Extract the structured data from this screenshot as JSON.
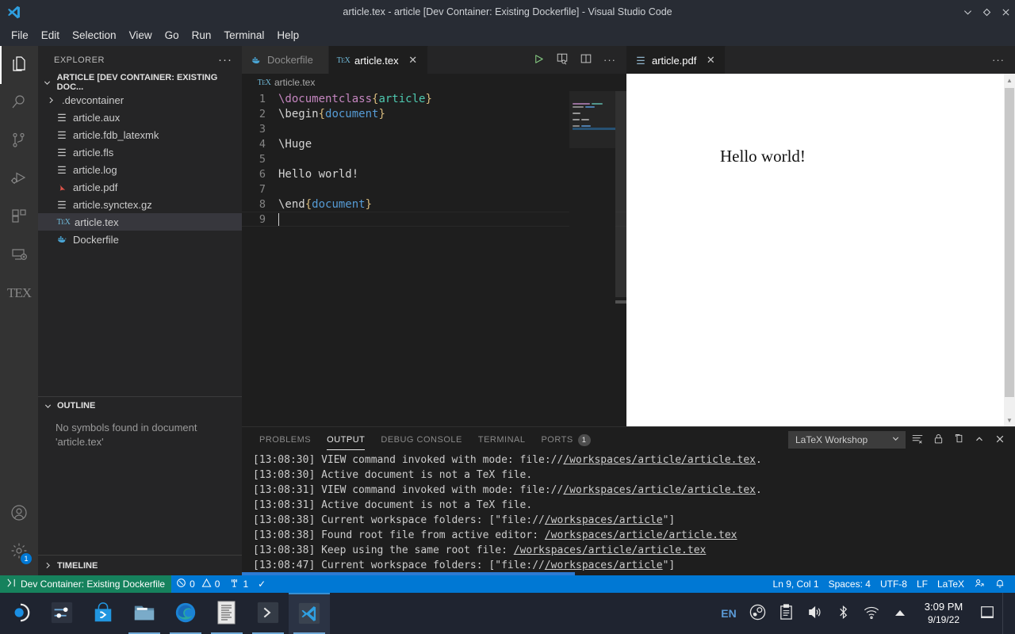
{
  "titlebar": {
    "title": "article.tex - article [Dev Container: Existing Dockerfile] - Visual Studio Code",
    "logo_icon": "vscode-logo-icon",
    "controls": [
      {
        "name": "minimize-button",
        "glyph": "⌄"
      },
      {
        "name": "maximize-button",
        "glyph": "◇"
      },
      {
        "name": "close-button",
        "glyph": "✕"
      }
    ]
  },
  "menubar": {
    "items": [
      "File",
      "Edit",
      "Selection",
      "View",
      "Go",
      "Run",
      "Terminal",
      "Help"
    ]
  },
  "activitybar": {
    "items": [
      {
        "name": "explorer",
        "icon": "files-icon",
        "active": true
      },
      {
        "name": "search",
        "icon": "search-icon",
        "active": false
      },
      {
        "name": "source-control",
        "icon": "source-control-icon",
        "active": false
      },
      {
        "name": "run-debug",
        "icon": "run-debug-icon",
        "active": false
      },
      {
        "name": "extensions",
        "icon": "extensions-icon",
        "active": false
      },
      {
        "name": "remote-explorer",
        "icon": "remote-explorer-icon",
        "active": false
      },
      {
        "name": "latex-workshop",
        "icon": "tex-icon",
        "label": "TEX",
        "active": false
      }
    ],
    "bottom": [
      {
        "name": "accounts",
        "icon": "account-icon"
      },
      {
        "name": "manage-settings",
        "icon": "gear-icon",
        "badge": "1"
      }
    ]
  },
  "sidebar": {
    "title": "EXPLORER",
    "more_actions": "···",
    "root_label": "ARTICLE [DEV CONTAINER: EXISTING DOC...",
    "files": [
      {
        "label": ".devcontainer",
        "icon": "folder-chevron-icon",
        "type": "folder",
        "selected": false
      },
      {
        "label": "article.aux",
        "icon": "file-lines-icon",
        "type": "file",
        "selected": false
      },
      {
        "label": "article.fdb_latexmk",
        "icon": "file-lines-icon",
        "type": "file",
        "selected": false
      },
      {
        "label": "article.fls",
        "icon": "file-lines-icon",
        "type": "file",
        "selected": false
      },
      {
        "label": "article.log",
        "icon": "file-lines-icon",
        "type": "file",
        "selected": false
      },
      {
        "label": "article.pdf",
        "icon": "pdf-icon",
        "type": "file",
        "selected": false
      },
      {
        "label": "article.synctex.gz",
        "icon": "file-lines-icon",
        "type": "file",
        "selected": false
      },
      {
        "label": "article.tex",
        "icon": "tex-file-icon",
        "type": "file",
        "selected": true
      },
      {
        "label": "Dockerfile",
        "icon": "docker-icon",
        "type": "file",
        "selected": false
      }
    ],
    "outline": {
      "title": "OUTLINE",
      "message_line1": "No symbols found in document",
      "message_line2": "'article.tex'"
    },
    "timeline": {
      "title": "TIMELINE"
    }
  },
  "editor": {
    "tabs": [
      {
        "label": "Dockerfile",
        "icon": "docker-icon",
        "active": false,
        "closable": false
      },
      {
        "label": "article.tex",
        "icon": "tex-file-icon",
        "active": true,
        "closable": true,
        "close_glyph": "✕"
      }
    ],
    "actions": [
      {
        "name": "build-latex-project-button",
        "icon": "play-icon"
      },
      {
        "name": "synctex-view-button",
        "icon": "view-pdf-icon"
      },
      {
        "name": "split-editor-right-button",
        "icon": "split-editor-icon"
      },
      {
        "name": "more-actions-button",
        "icon": "ellipsis-icon",
        "glyph": "···"
      }
    ],
    "breadcrumb": {
      "icon": "tex-file-icon",
      "label": "article.tex"
    },
    "lines": [
      {
        "n": "1",
        "tokens": [
          {
            "t": "\\documentclass",
            "c": "k-cmd"
          },
          {
            "t": "{",
            "c": "k-brace"
          },
          {
            "t": "article",
            "c": "k-arg-green"
          },
          {
            "t": "}",
            "c": "k-brace"
          }
        ]
      },
      {
        "n": "2",
        "tokens": [
          {
            "t": "\\begin",
            "c": "ctext"
          },
          {
            "t": "{",
            "c": "k-brace"
          },
          {
            "t": "document",
            "c": "k-arg-blue"
          },
          {
            "t": "}",
            "c": "k-brace"
          }
        ]
      },
      {
        "n": "3",
        "tokens": []
      },
      {
        "n": "4",
        "tokens": [
          {
            "t": "\\Huge",
            "c": "ctext"
          }
        ]
      },
      {
        "n": "5",
        "tokens": []
      },
      {
        "n": "6",
        "tokens": [
          {
            "t": "Hello world!",
            "c": "ctext"
          }
        ]
      },
      {
        "n": "7",
        "tokens": []
      },
      {
        "n": "8",
        "tokens": [
          {
            "t": "\\end",
            "c": "ctext"
          },
          {
            "t": "{",
            "c": "k-brace"
          },
          {
            "t": "document",
            "c": "k-arg-blue"
          },
          {
            "t": "}",
            "c": "k-brace"
          }
        ]
      },
      {
        "n": "9",
        "tokens": [],
        "cursor": true
      }
    ]
  },
  "pdf": {
    "tab": {
      "label": "article.pdf",
      "icon": "pdf-preview-icon",
      "close_glyph": "✕"
    },
    "more_actions": "···",
    "page_text": "Hello world!"
  },
  "panel": {
    "tabs": [
      {
        "label": "PROBLEMS",
        "active": false
      },
      {
        "label": "OUTPUT",
        "active": true
      },
      {
        "label": "DEBUG CONSOLE",
        "active": false
      },
      {
        "label": "TERMINAL",
        "active": false
      },
      {
        "label": "PORTS",
        "active": false,
        "badge": "1"
      }
    ],
    "channel_selected": "LaTeX Workshop",
    "channel_chevron": "chevron-down-icon",
    "actions": [
      {
        "name": "clear-output-button",
        "icon": "clear-output-icon"
      },
      {
        "name": "turn-auto-scrolling-off-button",
        "icon": "lock-icon"
      },
      {
        "name": "open-output-in-editor-button",
        "icon": "open-editor-icon"
      },
      {
        "name": "maximize-panel-button",
        "icon": "chevron-up-icon",
        "glyph": "⌃"
      },
      {
        "name": "close-panel-button",
        "icon": "close-icon",
        "glyph": "✕"
      }
    ],
    "output_lines": [
      [
        {
          "t": "[13:08:30] VIEW command invoked with mode: file://",
          "link": false
        },
        {
          "t": "/workspaces/article/article.tex",
          "link": true
        },
        {
          "t": ".",
          "link": false
        }
      ],
      [
        {
          "t": "[13:08:30] Active document is not a TeX file.",
          "link": false
        }
      ],
      [
        {
          "t": "[13:08:31] VIEW command invoked with mode: file://",
          "link": false
        },
        {
          "t": "/workspaces/article/article.tex",
          "link": true
        },
        {
          "t": ".",
          "link": false
        }
      ],
      [
        {
          "t": "[13:08:31] Active document is not a TeX file.",
          "link": false
        }
      ],
      [
        {
          "t": "[13:08:38] Current workspace folders: [\"file://",
          "link": false
        },
        {
          "t": "/workspaces/article",
          "link": true
        },
        {
          "t": "\"]",
          "link": false
        }
      ],
      [
        {
          "t": "[13:08:38] Found root file from active editor: ",
          "link": false
        },
        {
          "t": "/workspaces/article/article.tex",
          "link": true
        }
      ],
      [
        {
          "t": "[13:08:38] Keep using the same root file: ",
          "link": false
        },
        {
          "t": "/workspaces/article/article.tex",
          "link": true
        }
      ],
      [
        {
          "t": "[13:08:47] Current workspace folders: [\"file://",
          "link": false
        },
        {
          "t": "/workspaces/article",
          "link": true
        },
        {
          "t": "\"]",
          "link": false
        }
      ]
    ]
  },
  "statusbar": {
    "remote": {
      "label": "Dev Container: Existing Dockerfile",
      "icon": "remote-indicator-icon"
    },
    "errors": "0",
    "warnings": "0",
    "ports_count": "1",
    "check_glyph": "✓",
    "position": "Ln 9, Col 1",
    "indent": "Spaces: 4",
    "encoding": "UTF-8",
    "eol": "LF",
    "language": "LaTeX",
    "right_icons": [
      {
        "name": "live-share-button",
        "icon": "live-share-icon"
      },
      {
        "name": "notifications-button",
        "icon": "bell-icon"
      }
    ]
  },
  "taskbar": {
    "items": [
      {
        "name": "start-button",
        "icon": "start-circle-icon"
      },
      {
        "name": "settings-taskbar-button",
        "icon": "sliders-icon"
      },
      {
        "name": "microsoft-store-button",
        "icon": "store-bag-icon"
      },
      {
        "name": "file-explorer-button",
        "icon": "folder-icon",
        "running": true
      },
      {
        "name": "microsoft-edge-button",
        "icon": "edge-icon",
        "running": true
      },
      {
        "name": "notepad-button",
        "icon": "document-icon",
        "running": true
      },
      {
        "name": "terminal-button",
        "icon": "terminal-prompt-icon",
        "running": true
      },
      {
        "name": "vscode-taskbar-button",
        "icon": "vscode-logo-icon",
        "running": true,
        "active": true
      }
    ],
    "tray": {
      "language": "EN",
      "icons": [
        {
          "name": "steam-tray-icon",
          "icon": "steam-icon"
        },
        {
          "name": "clipboard-tray-icon",
          "icon": "clipboard-icon"
        },
        {
          "name": "volume-tray-icon",
          "icon": "speaker-icon"
        },
        {
          "name": "bluetooth-tray-icon",
          "icon": "bluetooth-icon"
        },
        {
          "name": "network-tray-icon",
          "icon": "wifi-icon"
        },
        {
          "name": "show-hidden-icons-button",
          "icon": "chevron-up-icon"
        }
      ],
      "time": "3:09 PM",
      "date": "9/19/22",
      "notification_icon": "notification-panel-icon"
    }
  },
  "colors": {
    "accent_blue": "#0078d4",
    "remote_green": "#16825d",
    "tex_magenta": "#c586c0",
    "brace_gold": "#d7ba7d",
    "arg_teal": "#4ec9b0",
    "arg_blue": "#569cd6",
    "play_green": "#89d185"
  }
}
